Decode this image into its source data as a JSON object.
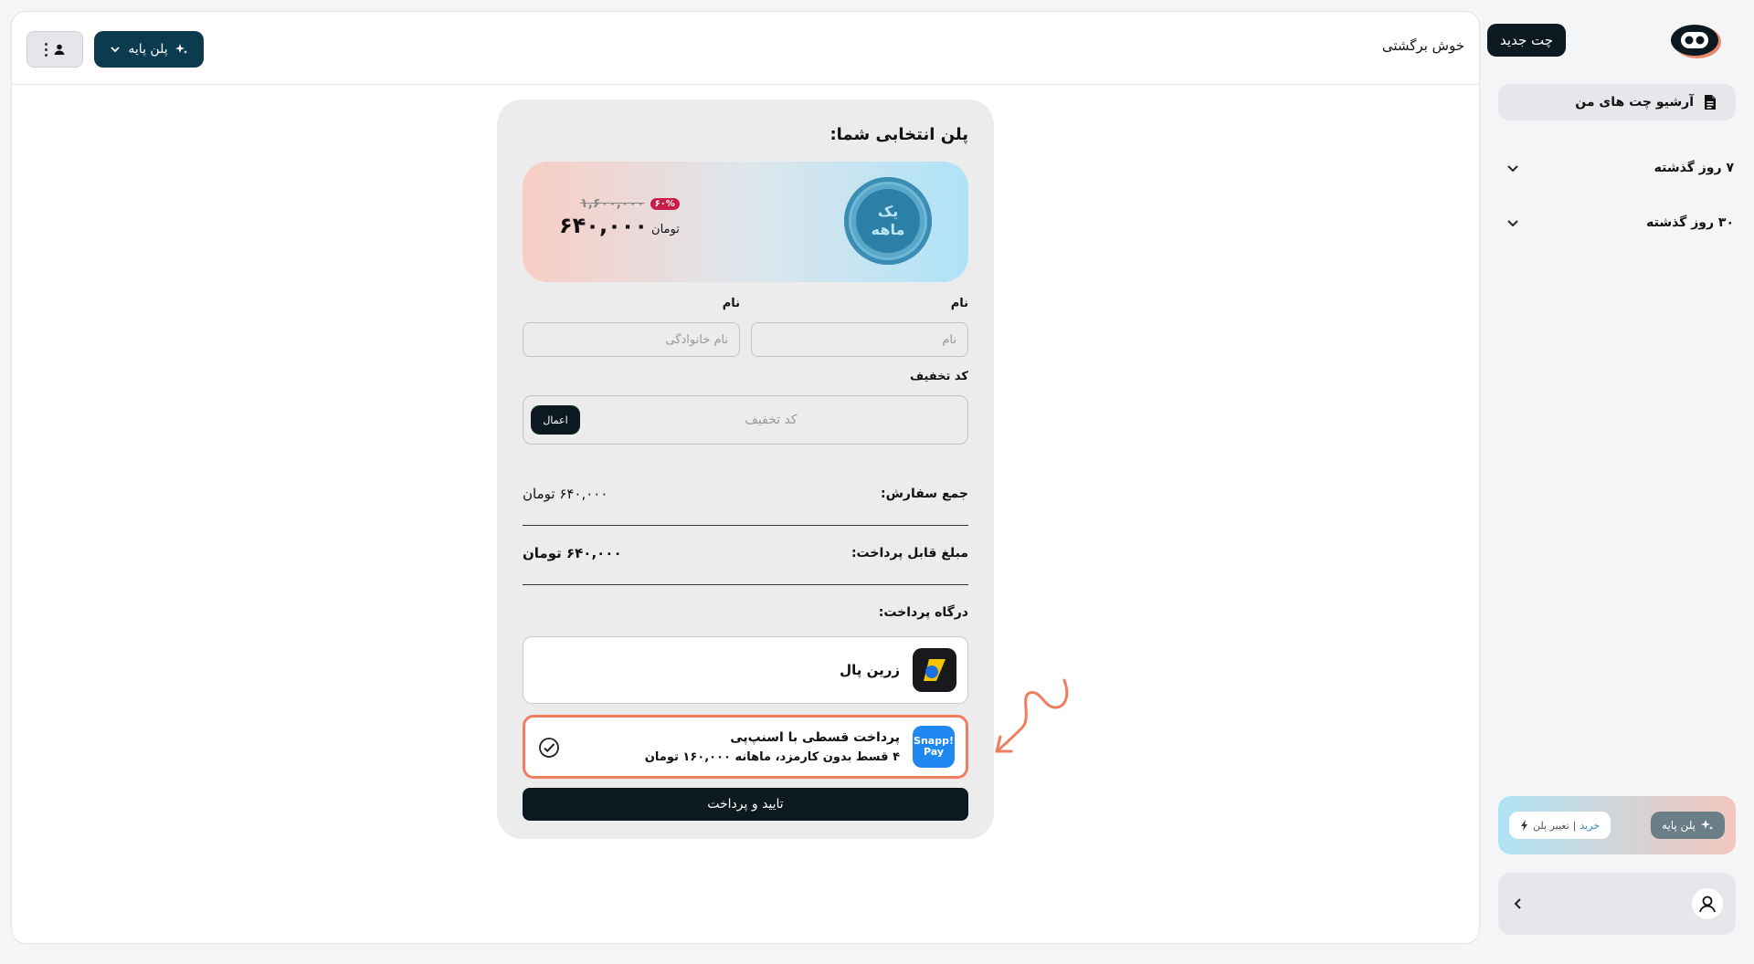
{
  "sidebar": {
    "logo_icon": "robot-face-icon",
    "new_chat_label": "چت جدید",
    "archive_label": "آرشیو چت های من",
    "archive_icon": "document-icon",
    "history": [
      {
        "label": "۷ روز گذشته",
        "icon": "chevron-down-icon"
      },
      {
        "label": "۳۰ روز گذشته",
        "icon": "chevron-down-icon"
      }
    ],
    "plan_card": {
      "plan_label": "پلن پایه",
      "buy_label": "خرید",
      "separator": "|",
      "change_label": "تغییر پلن",
      "accent_start": "#aee3f5",
      "accent_end": "#f3c6bd"
    },
    "user_card": {
      "avatar_icon": "user-icon",
      "chevron_icon": "chevron-left-icon"
    }
  },
  "header": {
    "welcome": "خوش برگشتی",
    "plan_dropdown_label": "پلن پایه",
    "plan_dropdown_color": "#0c3a4f"
  },
  "checkout": {
    "title": "پلن انتخابی شما:",
    "plan": {
      "coin_line1": "یک",
      "coin_line2": "ماهه",
      "old_price": "۱,۶۰۰,۰۰۰",
      "discount": "۶۰%",
      "new_price": "۶۴۰,۰۰۰",
      "unit": "تومان"
    },
    "first_name_label": "نام",
    "last_name_label": "نام",
    "first_name_placeholder": "نام",
    "last_name_placeholder": "نام خانوادگی",
    "discount_label": "کد تخفیف",
    "discount_placeholder": "کد تخفیف",
    "apply_label": "اعمال",
    "order_total_label": "جمع سفارش:",
    "order_total_value": "۶۴۰,۰۰۰ تومان",
    "payable_label": "مبلغ قابل پرداخت:",
    "payable_value": "۶۴۰,۰۰۰ تومان",
    "gateway_label": "درگاه پرداخت:",
    "gateways": {
      "zarinpal": "زرین پال",
      "snapp_title": "پرداخت قسطی با اسنپ‌پی",
      "snapp_subtitle": "۴ قسط بدون کارمزد، ماهانه ۱۶۰,۰۰۰ تومان",
      "snapp_logo_line1": "Snapp!",
      "snapp_logo_line2": "Pay",
      "selected_border_color": "#f07d5e"
    },
    "pay_label": "تایید و پرداخت"
  }
}
